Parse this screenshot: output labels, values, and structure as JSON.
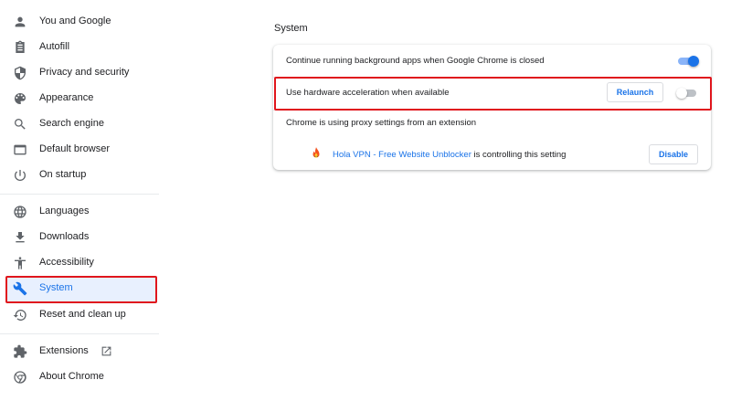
{
  "sidebar": {
    "items": [
      {
        "label": "You and Google",
        "icon": "person-icon"
      },
      {
        "label": "Autofill",
        "icon": "clipboard-icon"
      },
      {
        "label": "Privacy and security",
        "icon": "shield-icon"
      },
      {
        "label": "Appearance",
        "icon": "palette-icon"
      },
      {
        "label": "Search engine",
        "icon": "search-icon"
      },
      {
        "label": "Default browser",
        "icon": "browser-window-icon"
      },
      {
        "label": "On startup",
        "icon": "power-icon"
      },
      {
        "label": "Languages",
        "icon": "globe-icon"
      },
      {
        "label": "Downloads",
        "icon": "download-icon"
      },
      {
        "label": "Accessibility",
        "icon": "accessibility-icon"
      },
      {
        "label": "System",
        "icon": "wrench-icon"
      },
      {
        "label": "Reset and clean up",
        "icon": "history-icon"
      },
      {
        "label": "Extensions",
        "icon": "puzzle-icon"
      },
      {
        "label": "About Chrome",
        "icon": "chrome-icon"
      }
    ],
    "active": "System"
  },
  "main": {
    "section_title": "System",
    "rows": {
      "background_apps": {
        "label": "Continue running background apps when Google Chrome is closed",
        "enabled": true
      },
      "hardware_acceleration": {
        "label": "Use hardware acceleration when available",
        "enabled": false,
        "button": "Relaunch"
      },
      "proxy": {
        "label": "Chrome is using proxy settings from an extension"
      },
      "extension": {
        "name": "Hola VPN - Free Website Unblocker",
        "suffix": " is controlling this setting",
        "button": "Disable"
      }
    }
  },
  "colors": {
    "accent": "#1a73e8",
    "highlight": "#e0161d",
    "active_bg": "#e8f0fe"
  }
}
